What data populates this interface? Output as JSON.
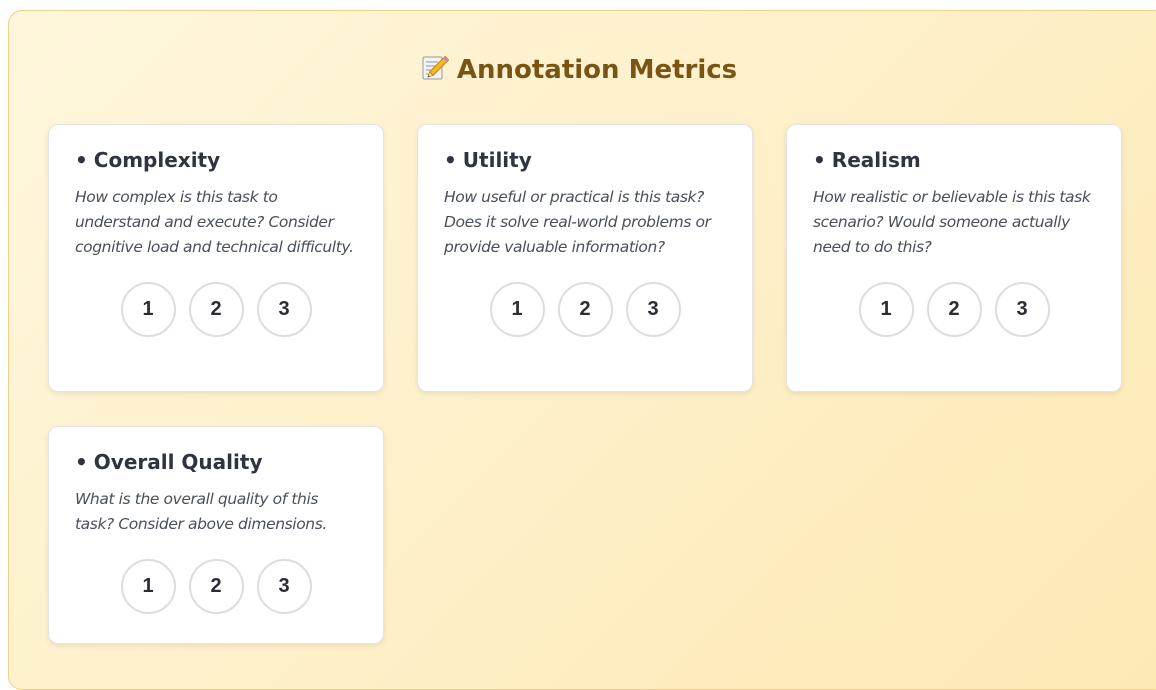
{
  "panel": {
    "title": "Annotation Metrics",
    "title_icon": "memo-pencil-icon"
  },
  "metrics": [
    {
      "bullet": "•",
      "name": "Complexity",
      "description": "How complex is this task to understand and execute? Consider cognitive load and technical difficulty.",
      "options": [
        "1",
        "2",
        "3"
      ]
    },
    {
      "bullet": "•",
      "name": "Utility",
      "description": "How useful or practical is this task? Does it solve real-world problems or provide valuable information?",
      "options": [
        "1",
        "2",
        "3"
      ]
    },
    {
      "bullet": "•",
      "name": "Realism",
      "description": "How realistic or believable is this task scenario? Would someone actually need to do this?",
      "options": [
        "1",
        "2",
        "3"
      ]
    },
    {
      "bullet": "•",
      "name": "Overall Quality",
      "description": "What is the overall quality of this task? Consider above dimensions.",
      "options": [
        "1",
        "2",
        "3"
      ]
    }
  ],
  "colors": {
    "panel_background": "#fdebb8",
    "panel_border": "#f0cf86",
    "title_color": "#7a5413",
    "card_background": "#ffffff",
    "button_border": "#dddddd"
  }
}
